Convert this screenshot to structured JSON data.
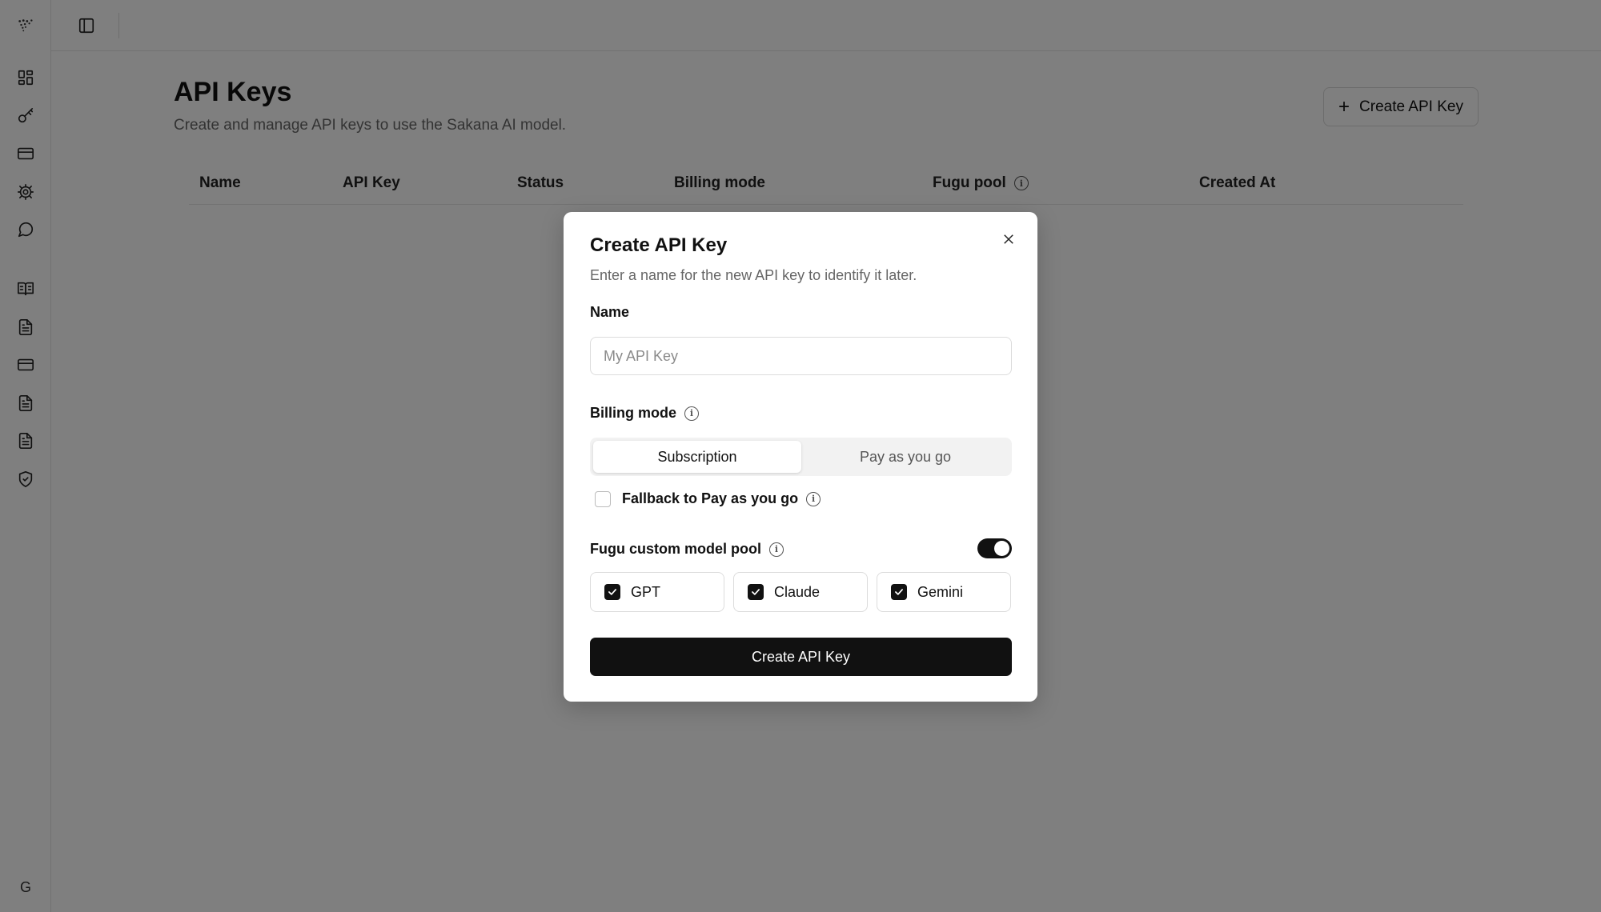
{
  "sidebar": {
    "items": [
      {
        "icon": "logo-icon"
      },
      {
        "icon": "dashboard-icon"
      },
      {
        "icon": "key-icon"
      },
      {
        "icon": "credit-card-icon"
      },
      {
        "icon": "gear-icon"
      },
      {
        "icon": "chat-icon"
      },
      {
        "icon": "book-icon"
      },
      {
        "icon": "document-icon"
      },
      {
        "icon": "credit-card-icon"
      },
      {
        "icon": "document-icon"
      },
      {
        "icon": "document-icon"
      },
      {
        "icon": "shield-check-icon"
      }
    ],
    "avatar_letter": "G"
  },
  "topbar": {
    "toggle_icon": "sidebar-toggle-icon"
  },
  "page": {
    "title": "API Keys",
    "subtitle": "Create and manage API keys to use the Sakana AI model.",
    "create_button_label": "Create API Key",
    "table": {
      "columns": [
        "Name",
        "API Key",
        "Status",
        "Billing mode",
        "Fugu pool",
        "Created At"
      ]
    }
  },
  "modal": {
    "title": "Create API Key",
    "description": "Enter a name for the new API key to identify it later.",
    "name_label": "Name",
    "name_placeholder": "My API Key",
    "name_value": "",
    "billing_label": "Billing mode",
    "billing_options": [
      "Subscription",
      "Pay as you go"
    ],
    "billing_selected": "Subscription",
    "fallback_label": "Fallback to Pay as you go",
    "fallback_checked": false,
    "pool_label": "Fugu custom model pool",
    "pool_enabled": true,
    "models": [
      {
        "label": "GPT",
        "checked": true
      },
      {
        "label": "Claude",
        "checked": true
      },
      {
        "label": "Gemini",
        "checked": true
      }
    ],
    "submit_label": "Create API Key"
  },
  "colors": {
    "primary": "#111111",
    "overlay": "rgba(0,0,0,0.5)",
    "border": "#dcdcdc",
    "muted_text": "#666666"
  }
}
